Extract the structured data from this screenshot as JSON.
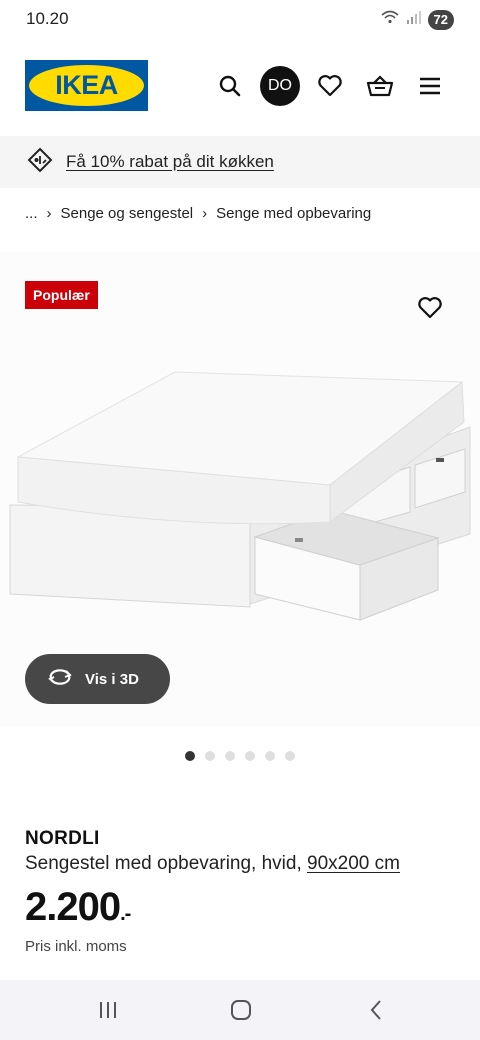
{
  "status": {
    "time": "10.20",
    "battery": "72"
  },
  "header": {
    "logo_text": "IKEA",
    "avatar_initials": "DO"
  },
  "promo": {
    "text": "Få 10% rabat på dit køkken"
  },
  "breadcrumb": {
    "ellipsis": "...",
    "items": [
      "Senge og sengestel",
      "Senge med opbevaring"
    ]
  },
  "product_image": {
    "badge": "Populær",
    "view_3d_label": "Vis i 3D",
    "carousel_total": 6,
    "carousel_active": 1
  },
  "product": {
    "name": "NORDLI",
    "description": "Sengestel med opbevaring, hvid, ",
    "size": "90x200 cm",
    "price": "2.200",
    "price_suffix": ".-",
    "price_note": "Pris inkl. moms"
  },
  "colors": {
    "ikea_blue": "#0058a3",
    "ikea_yellow": "#ffdb00",
    "badge_red": "#cc0008"
  }
}
